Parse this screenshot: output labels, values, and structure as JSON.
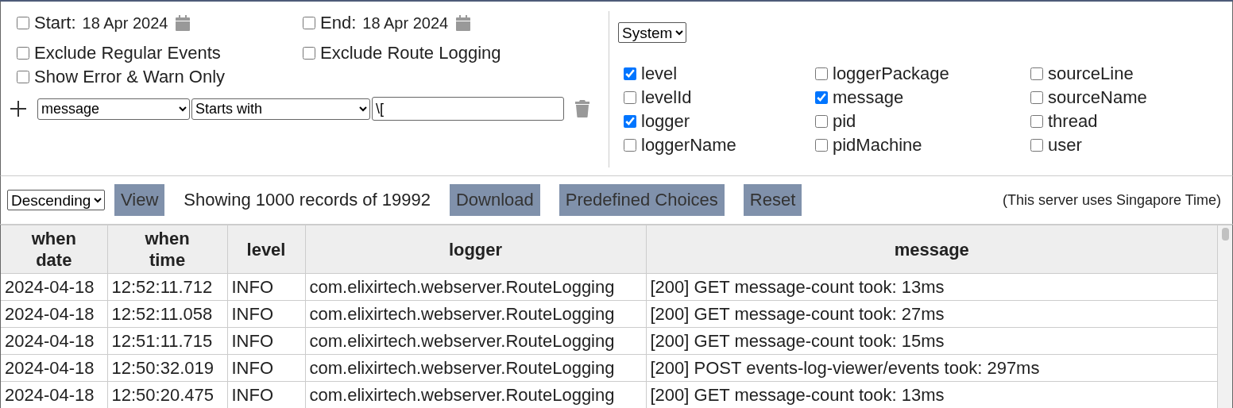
{
  "filters": {
    "start": {
      "label": "Start:",
      "date": "18 Apr 2024",
      "checked": false
    },
    "end": {
      "label": "End:",
      "date": "18 Apr 2024",
      "checked": false
    },
    "options": [
      {
        "label": "Exclude Regular Events",
        "checked": false
      },
      {
        "label": "Exclude Route Logging",
        "checked": false
      },
      {
        "label": "Show Error & Warn Only",
        "checked": false
      }
    ],
    "condition": {
      "field": "message",
      "operator": "Starts with",
      "value": "\\["
    }
  },
  "columns_panel": {
    "preset": "System",
    "fields": [
      {
        "label": "level",
        "checked": true
      },
      {
        "label": "levelId",
        "checked": false
      },
      {
        "label": "logger",
        "checked": true
      },
      {
        "label": "loggerName",
        "checked": false
      },
      {
        "label": "loggerPackage",
        "checked": false
      },
      {
        "label": "message",
        "checked": true
      },
      {
        "label": "pid",
        "checked": false
      },
      {
        "label": "pidMachine",
        "checked": false
      },
      {
        "label": "sourceLine",
        "checked": false
      },
      {
        "label": "sourceName",
        "checked": false
      },
      {
        "label": "thread",
        "checked": false
      },
      {
        "label": "user",
        "checked": false
      }
    ]
  },
  "toolbar": {
    "sort": "Descending",
    "view_button": "View",
    "record_count": "Showing 1000 records of 19992",
    "buttons": [
      "Download",
      "Predefined Choices",
      "Reset"
    ],
    "timezone_note": "(This server uses Singapore Time)"
  },
  "table": {
    "columns": [
      "when\ndate",
      "when\ntime",
      "level",
      "logger",
      "message"
    ],
    "rows": [
      [
        "2024-04-18",
        "12:52:11.712",
        "INFO",
        "com.elixirtech.webserver.RouteLogging",
        "[200] GET message-count took: 13ms"
      ],
      [
        "2024-04-18",
        "12:52:11.058",
        "INFO",
        "com.elixirtech.webserver.RouteLogging",
        "[200] GET message-count took: 27ms"
      ],
      [
        "2024-04-18",
        "12:51:11.715",
        "INFO",
        "com.elixirtech.webserver.RouteLogging",
        "[200] GET message-count took: 15ms"
      ],
      [
        "2024-04-18",
        "12:50:32.019",
        "INFO",
        "com.elixirtech.webserver.RouteLogging",
        "[200] POST events-log-viewer/events took: 297ms"
      ],
      [
        "2024-04-18",
        "12:50:20.475",
        "INFO",
        "com.elixirtech.webserver.RouteLogging",
        "[200] GET message-count took: 13ms"
      ]
    ]
  }
}
